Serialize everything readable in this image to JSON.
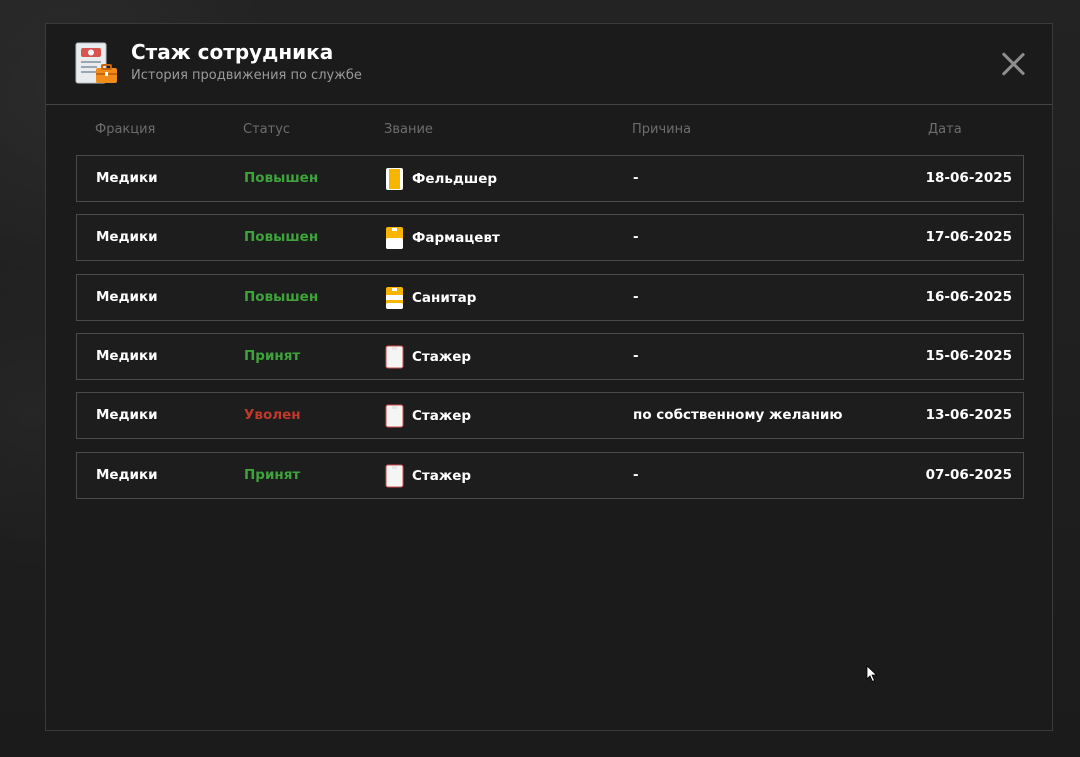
{
  "modal": {
    "title": "Стаж сотрудника",
    "subtitle": "История продвижения по службе",
    "icon": "document-briefcase-icon",
    "close_icon": "close-icon"
  },
  "columns": {
    "faction": "Фракция",
    "status": "Статус",
    "rank": "Звание",
    "reason": "Причина",
    "date": "Дата"
  },
  "colors": {
    "promoted": "#3ea33a",
    "hired": "#3ea33a",
    "fired": "#c0392b",
    "rank_gold": "#f7b500",
    "rank_white": "#f2f2f2"
  },
  "rows": [
    {
      "faction": "Медики",
      "status": "Повышен",
      "status_kind": "promoted",
      "rank": "Фельдшер",
      "rank_icon": "badge-gold-full-icon",
      "reason": "-",
      "date": "18-06-2025"
    },
    {
      "faction": "Медики",
      "status": "Повышен",
      "status_kind": "promoted",
      "rank": "Фармацевт",
      "rank_icon": "badge-gold-top-icon",
      "reason": "-",
      "date": "17-06-2025"
    },
    {
      "faction": "Медики",
      "status": "Повышен",
      "status_kind": "promoted",
      "rank": "Санитар",
      "rank_icon": "badge-gold-stripes-icon",
      "reason": "-",
      "date": "16-06-2025"
    },
    {
      "faction": "Медики",
      "status": "Принят",
      "status_kind": "hired",
      "rank": "Стажер",
      "rank_icon": "badge-white-icon",
      "reason": "-",
      "date": "15-06-2025"
    },
    {
      "faction": "Медики",
      "status": "Уволен",
      "status_kind": "fired",
      "rank": "Стажер",
      "rank_icon": "badge-white-icon",
      "reason": "по собственному желанию",
      "date": "13-06-2025"
    },
    {
      "faction": "Медики",
      "status": "Принят",
      "status_kind": "hired",
      "rank": "Стажер",
      "rank_icon": "badge-white-icon",
      "reason": "-",
      "date": "07-06-2025"
    }
  ]
}
